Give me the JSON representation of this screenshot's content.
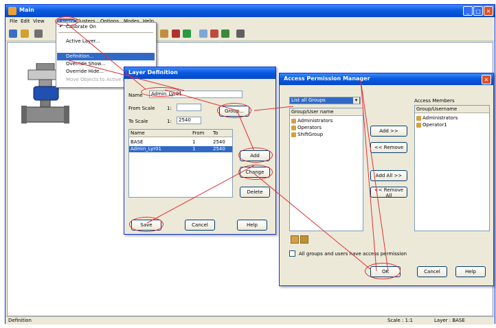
{
  "app": {
    "title": "Main"
  },
  "menu": {
    "items": [
      "File",
      "Edit",
      "View",
      "Layers",
      "Clusters",
      "Options",
      "Modes",
      "Help"
    ]
  },
  "layers_menu": {
    "items": [
      "Calibrate On",
      "Active Layer...",
      "Definition...",
      "Override Show...",
      "Override Hide...",
      "Move Objects to Active Layer"
    ]
  },
  "layer_dialog": {
    "title": "Layer Definition",
    "name_label": "Name",
    "name_value": "Admin_Lyr01",
    "from_scale_label": "From Scale",
    "from_scale_prefix": "1:",
    "from_scale_value": "",
    "to_scale_label": "To Scale",
    "to_scale_prefix": "1:",
    "to_scale_value": "2540",
    "columns": [
      "Name",
      "From",
      "To"
    ],
    "rows": [
      [
        "BASE",
        "1",
        "2540"
      ],
      [
        "Admin_Lyr01",
        "1",
        "2540"
      ]
    ],
    "group_button": "Group...",
    "add_button": "Add",
    "change_button": "Change",
    "delete_button": "Delete",
    "save_button": "Save",
    "cancel_button": "Cancel",
    "help_button": "Help"
  },
  "apm_dialog": {
    "title": "Access Permission Manager",
    "close_glyph": "✕",
    "group_select": "List all Groups",
    "left_header": "Group/User name",
    "left_items": [
      "Administrators",
      "Operators",
      "ShiftGroup"
    ],
    "right_label": "Access Members",
    "right_header": "Group/Username",
    "right_items": [
      "Administrators",
      "Operator1"
    ],
    "add_button": "Add >>",
    "remove_button": "<< Remove",
    "add_all_button": "Add All >>",
    "remove_all_button": "<< Remove All",
    "checkbox_label": "All groups and users have access permission",
    "ok_button": "OK",
    "cancel_button": "Cancel",
    "help_button": "Help"
  },
  "status": {
    "left": "Definition",
    "scale": "Scale : 1:1",
    "layer": "Layer : BASE"
  },
  "colors": {
    "title_bar": "#0a5ae0",
    "window_face": "#ece9d8",
    "annotation": "#e03030",
    "selection": "#316ac5"
  },
  "icons": [
    "app-icon",
    "minimize-icon",
    "maximize-icon",
    "close-icon",
    "valve-icon",
    "check-icon",
    "user-group-icon"
  ]
}
